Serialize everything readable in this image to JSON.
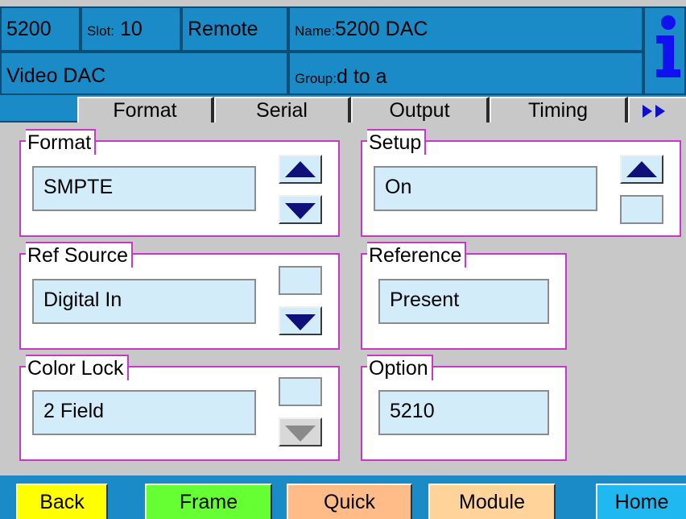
{
  "header": {
    "model": "5200",
    "slot_label": "Slot:",
    "slot_value": "10",
    "mode": "Remote",
    "name_label": "Name:",
    "name_value": "5200 DAC",
    "type": "Video DAC",
    "group_label": "Group:",
    "group_value": "d to a",
    "info_icon": "info-icon"
  },
  "tabs": [
    {
      "label": "Format"
    },
    {
      "label": "Serial"
    },
    {
      "label": "Output"
    },
    {
      "label": "Timing"
    }
  ],
  "tab_more_icon": "double-right-arrow-icon",
  "panels": {
    "format": {
      "label": "Format",
      "value": "SMPTE"
    },
    "setup": {
      "label": "Setup",
      "value": "On"
    },
    "ref_source": {
      "label": "Ref Source",
      "value": "Digital In"
    },
    "reference": {
      "label": "Reference",
      "value": "Present"
    },
    "color_lock": {
      "label": "Color Lock",
      "value": "2 Field"
    },
    "option": {
      "label": "Option",
      "value": "5210"
    }
  },
  "footer": {
    "back": "Back",
    "frame": "Frame",
    "quick": "Quick",
    "module": "Module",
    "home": "Home"
  },
  "colors": {
    "header_blue": "#1a8bc6",
    "panel_border": "#c838c8",
    "field_bg": "#d2ecfa",
    "back": "#ffff00",
    "frame": "#66ff33",
    "quick": "#ffbb88",
    "module": "#ffd399",
    "home": "#1fb8f0"
  }
}
